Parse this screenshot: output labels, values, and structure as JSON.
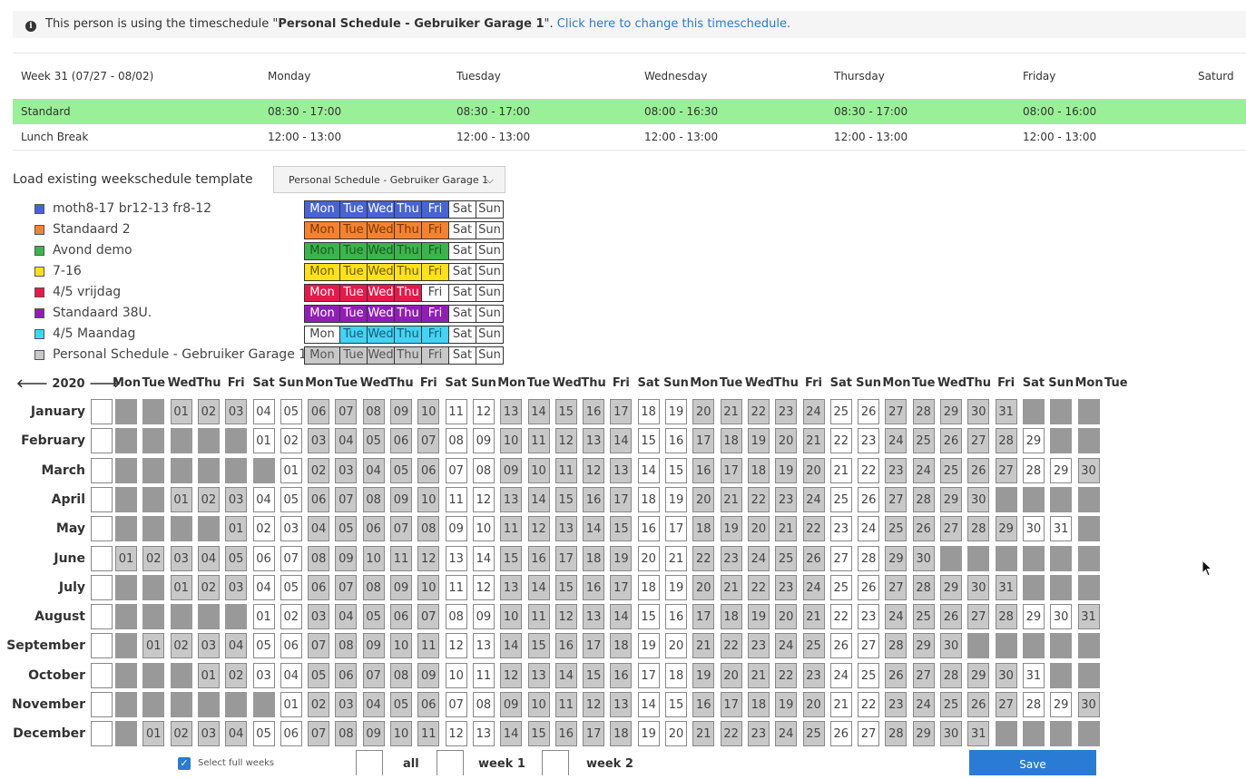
{
  "info": {
    "prefix": "This person is using the timeschedule \"",
    "schedule": "Personal Schedule - Gebruiker Garage 1",
    "suffix": "\". ",
    "link": "Click here to change this timeschedule."
  },
  "week_table": {
    "header": [
      "Week 31 (07/27 - 08/02)",
      "Monday",
      "Tuesday",
      "Wednesday",
      "Thursday",
      "Friday",
      "Saturd"
    ],
    "rows": [
      {
        "label": "Standard",
        "times": [
          "08:30 - 17:00",
          "08:30 - 17:00",
          "08:00 - 16:30",
          "08:30 - 17:00",
          "08:00 - 16:00"
        ]
      },
      {
        "label": "Lunch Break",
        "times": [
          "12:00 - 13:00",
          "12:00 - 13:00",
          "12:00 - 13:00",
          "12:00 - 13:00",
          "12:00 - 13:00"
        ]
      }
    ]
  },
  "template": {
    "label": "Load existing weekschedule template",
    "selected": "Personal Schedule - Gebruiker Garage 1"
  },
  "day_abbr": [
    "Mon",
    "Tue",
    "Wed",
    "Thu",
    "Fri",
    "Sat",
    "Sun"
  ],
  "legend": [
    {
      "name": "moth8-17 br12-13 fr8-12",
      "color": "#4763d4",
      "text": "#ffffff",
      "active": [
        1,
        1,
        1,
        1,
        1,
        0,
        0
      ]
    },
    {
      "name": "Standaard 2",
      "color": "#f58231",
      "text": "#7a3a00",
      "active": [
        1,
        1,
        1,
        1,
        1,
        0,
        0
      ]
    },
    {
      "name": "Avond demo",
      "color": "#3cb44b",
      "text": "#1d5a23",
      "active": [
        1,
        1,
        1,
        1,
        1,
        0,
        0
      ]
    },
    {
      "name": "7-16",
      "color": "#ffe119",
      "text": "#6a5a00",
      "active": [
        1,
        1,
        1,
        1,
        1,
        0,
        0
      ]
    },
    {
      "name": "4/5 vrijdag",
      "color": "#e6194b",
      "text": "#ffffff",
      "active": [
        1,
        1,
        1,
        1,
        0,
        0,
        0
      ]
    },
    {
      "name": "Standaard 38U.",
      "color": "#911eb4",
      "text": "#ffffff",
      "active": [
        1,
        1,
        1,
        1,
        1,
        0,
        0
      ]
    },
    {
      "name": "4/5 Maandag",
      "color": "#42d4f4",
      "text": "#1a5a70",
      "active": [
        0,
        1,
        1,
        1,
        1,
        0,
        0
      ]
    },
    {
      "name": "Personal Schedule - Gebruiker Garage 1",
      "color": "#c8c8c8",
      "text": "#555555",
      "active": [
        1,
        1,
        1,
        1,
        1,
        0,
        0
      ]
    }
  ],
  "calendar": {
    "year": "2020",
    "column_headers": [
      "Mon",
      "Tue",
      "Wed",
      "Thu",
      "Fri",
      "Sat",
      "Sun",
      "Mon",
      "Tue",
      "Wed",
      "Thu",
      "Fri",
      "Sat",
      "Sun",
      "Mon",
      "Tue",
      "Wed",
      "Thu",
      "Fri",
      "Sat",
      "Sun",
      "Mon",
      "Tue",
      "Wed",
      "Thu",
      "Fri",
      "Sat",
      "Sun",
      "Mon",
      "Tue",
      "Wed",
      "Thu",
      "Fri",
      "Sat",
      "Sun",
      "Mon",
      "Tue"
    ],
    "months": [
      {
        "name": "January",
        "offset": 2,
        "days": 31
      },
      {
        "name": "February",
        "offset": 5,
        "days": 29
      },
      {
        "name": "March",
        "offset": 6,
        "days": 31
      },
      {
        "name": "April",
        "offset": 2,
        "days": 30
      },
      {
        "name": "May",
        "offset": 4,
        "days": 31
      },
      {
        "name": "June",
        "offset": 0,
        "days": 30
      },
      {
        "name": "July",
        "offset": 2,
        "days": 31
      },
      {
        "name": "August",
        "offset": 5,
        "days": 31
      },
      {
        "name": "September",
        "offset": 1,
        "days": 30
      },
      {
        "name": "October",
        "offset": 3,
        "days": 31
      },
      {
        "name": "November",
        "offset": 6,
        "days": 30
      },
      {
        "name": "December",
        "offset": 1,
        "days": 31
      }
    ]
  },
  "footer": {
    "select_full_weeks": "Select full weeks",
    "all": "all",
    "week1": "week 1",
    "week2": "week 2",
    "save": "Save"
  }
}
